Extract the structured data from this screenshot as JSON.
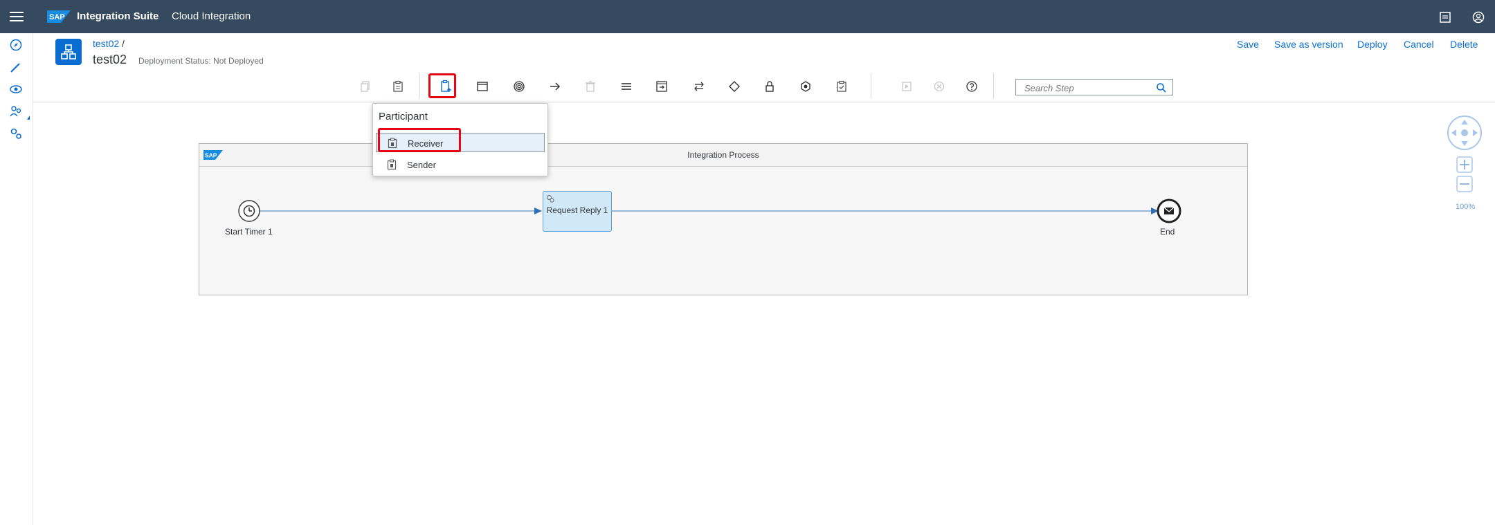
{
  "shell": {
    "product": "Integration Suite",
    "app": "Cloud Integration",
    "logo_text": "SAP"
  },
  "header": {
    "breadcrumb": "test02",
    "breadcrumb_sep": "/",
    "title": "test02",
    "status": "Deployment Status: Not Deployed"
  },
  "actions": {
    "save": "Save",
    "save_as_version": "Save as version",
    "deploy": "Deploy",
    "cancel": "Cancel",
    "delete": "Delete"
  },
  "search": {
    "placeholder": "Search Step"
  },
  "popup": {
    "header": "Participant",
    "items": [
      {
        "label": "Receiver",
        "selected": true
      },
      {
        "label": "Sender",
        "selected": false
      }
    ]
  },
  "canvas": {
    "pool_title": "Integration Process",
    "pool_logo_text": "SAP",
    "start_label": "Start Timer 1",
    "step_label": "Request Reply 1",
    "end_label": "End",
    "zoom": "100%"
  },
  "colors": {
    "shell": "#354a5f",
    "accent": "#0a6ed1",
    "highlight": "#e30613",
    "step_fill": "#d1e8f8"
  }
}
